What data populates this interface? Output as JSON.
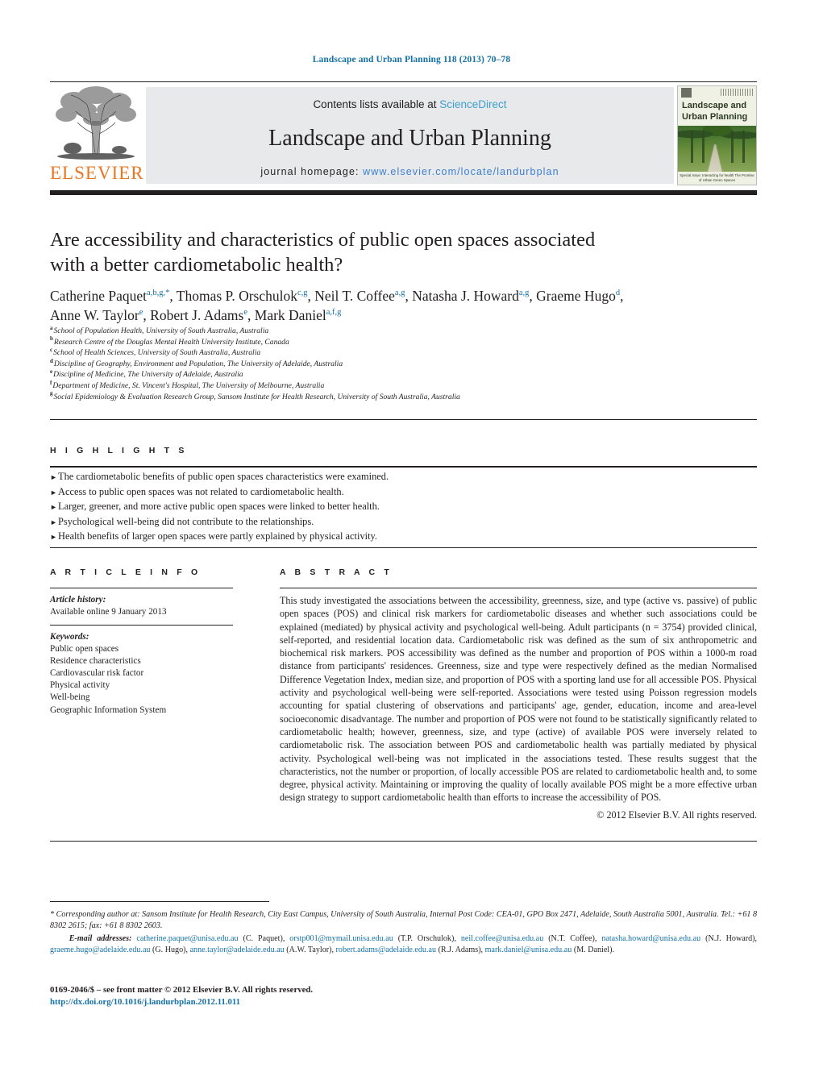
{
  "running_head": "Landscape and Urban Planning 118 (2013) 70–78",
  "masthead": {
    "publisher_name": "ELSEVIER",
    "contents_prefix": "Contents lists available at ",
    "contents_link": "ScienceDirect",
    "journal_title": "Landscape and Urban Planning",
    "homepage_label": "journal homepage: ",
    "homepage_url": "www.elsevier.com/locate/landurbplan",
    "cover": {
      "title_line1": "Landscape and",
      "title_line2": "Urban Planning",
      "caption": "Special Issue: Interacting for health\nThe Promise of Urban Green Spaces"
    }
  },
  "article": {
    "title_line1": "Are accessibility and characteristics of public open spaces associated",
    "title_line2": "with a better cardiometabolic health?",
    "authors": [
      {
        "name": "Catherine Paquet",
        "sup": "a,b,g,*"
      },
      {
        "name": "Thomas P. Orschulok",
        "sup": "c,g"
      },
      {
        "name": "Neil T. Coffee",
        "sup": "a,g"
      },
      {
        "name": "Natasha J. Howard",
        "sup": "a,g"
      },
      {
        "name": "Graeme Hugo",
        "sup": "d"
      },
      {
        "name": "Anne W. Taylor",
        "sup": "e"
      },
      {
        "name": "Robert J. Adams",
        "sup": "e"
      },
      {
        "name": "Mark Daniel",
        "sup": "a,f,g"
      }
    ],
    "affiliations": [
      {
        "mark": "a",
        "text": "School of Population Health, University of South Australia, Australia"
      },
      {
        "mark": "b",
        "text": "Research Centre of the Douglas Mental Health University Institute, Canada"
      },
      {
        "mark": "c",
        "text": "School of Health Sciences, University of South Australia, Australia"
      },
      {
        "mark": "d",
        "text": "Discipline of Geography, Environment and Population, The University of Adelaide, Australia"
      },
      {
        "mark": "e",
        "text": "Discipline of Medicine, The University of Adelaide, Australia"
      },
      {
        "mark": "f",
        "text": "Department of Medicine, St. Vincent's Hospital, The University of Melbourne, Australia"
      },
      {
        "mark": "g",
        "text": "Social Epidemiology & Evaluation Research Group, Sansom Institute for Health Research, University of South Australia, Australia"
      }
    ]
  },
  "highlights": {
    "heading": "H I G H L I G H T S",
    "items": [
      "The cardiometabolic benefits of public open spaces characteristics were examined.",
      "Access to public open spaces was not related to cardiometabolic health.",
      "Larger, greener, and more active public open spaces were linked to better health.",
      "Psychological well-being did not contribute to the relationships.",
      "Health benefits of larger open spaces were partly explained by physical activity."
    ]
  },
  "article_info": {
    "heading": "A R T I C L E   I N F O",
    "history_label": "Article history:",
    "history_value": "Available online 9 January 2013",
    "keywords_label": "Keywords:",
    "keywords": [
      "Public open spaces",
      "Residence characteristics",
      "Cardiovascular risk factor",
      "Physical activity",
      "Well-being",
      "Geographic Information System"
    ]
  },
  "abstract": {
    "heading": "A B S T R A C T",
    "body": "This study investigated the associations between the accessibility, greenness, size, and type (active vs. passive) of public open spaces (POS) and clinical risk markers for cardiometabolic diseases and whether such associations could be explained (mediated) by physical activity and psychological well-being. Adult participants (n = 3754) provided clinical, self-reported, and residential location data. Cardiometabolic risk was defined as the sum of six anthropometric and biochemical risk markers. POS accessibility was defined as the number and proportion of POS within a 1000-m road distance from participants' residences. Greenness, size and type were respectively defined as the median Normalised Difference Vegetation Index, median size, and proportion of POS with a sporting land use for all accessible POS. Physical activity and psychological well-being were self-reported. Associations were tested using Poisson regression models accounting for spatial clustering of observations and participants' age, gender, education, income and area-level socioeconomic disadvantage. The number and proportion of POS were not found to be statistically significantly related to cardiometabolic health; however, greenness, size, and type (active) of available POS were inversely related to cardiometabolic risk. The association between POS and cardiometabolic health was partially mediated by physical activity. Psychological well-being was not implicated in the associations tested. These results suggest that the characteristics, not the number or proportion, of locally accessible POS are related to cardiometabolic health and, to some degree, physical activity. Maintaining or improving the quality of locally available POS might be a more effective urban design strategy to support cardiometabolic health than efforts to increase the accessibility of POS.",
    "copyright": "© 2012 Elsevier B.V. All rights reserved."
  },
  "footnotes": {
    "corresponding": "* Corresponding author at: Sansom Institute for Health Research, City East Campus, University of South Australia, Internal Post Code: CEA-01, GPO Box 2471, Adelaide, South Australia 5001, Australia. Tel.: +61 8 8302 2615; fax: +61 8 8302 2603.",
    "email_label": "E-mail addresses:",
    "emails": [
      {
        "address": "catherine.paquet@unisa.edu.au",
        "person": "(C. Paquet),"
      },
      {
        "address": "orstp001@mymail.unisa.edu.au",
        "person": "(T.P. Orschulok),"
      },
      {
        "address": "neil.coffee@unisa.edu.au",
        "person": "(N.T. Coffee),"
      },
      {
        "address": "natasha.howard@unisa.edu.au",
        "person": "(N.J. Howard),"
      },
      {
        "address": "graeme.hugo@adelaide.edu.au",
        "person": "(G. Hugo),"
      },
      {
        "address": "anne.taylor@adelaide.edu.au",
        "person": "(A.W. Taylor),"
      },
      {
        "address": "robert.adams@adelaide.edu.au",
        "person": "(R.J. Adams),"
      },
      {
        "address": "mark.daniel@unisa.edu.au",
        "person": "(M. Daniel)."
      }
    ]
  },
  "imprint": {
    "issn_line": "0169-2046/$ – see front matter © 2012 Elsevier B.V. All rights reserved.",
    "doi": "http://dx.doi.org/10.1016/j.landurbplan.2012.11.011"
  },
  "colors": {
    "link_blue": "#1571a6",
    "sciencedirect_blue": "#3d9fd0",
    "elsevier_orange": "#e87722",
    "rule_black": "#231f20",
    "banner_gray": "#e7e9ea"
  }
}
